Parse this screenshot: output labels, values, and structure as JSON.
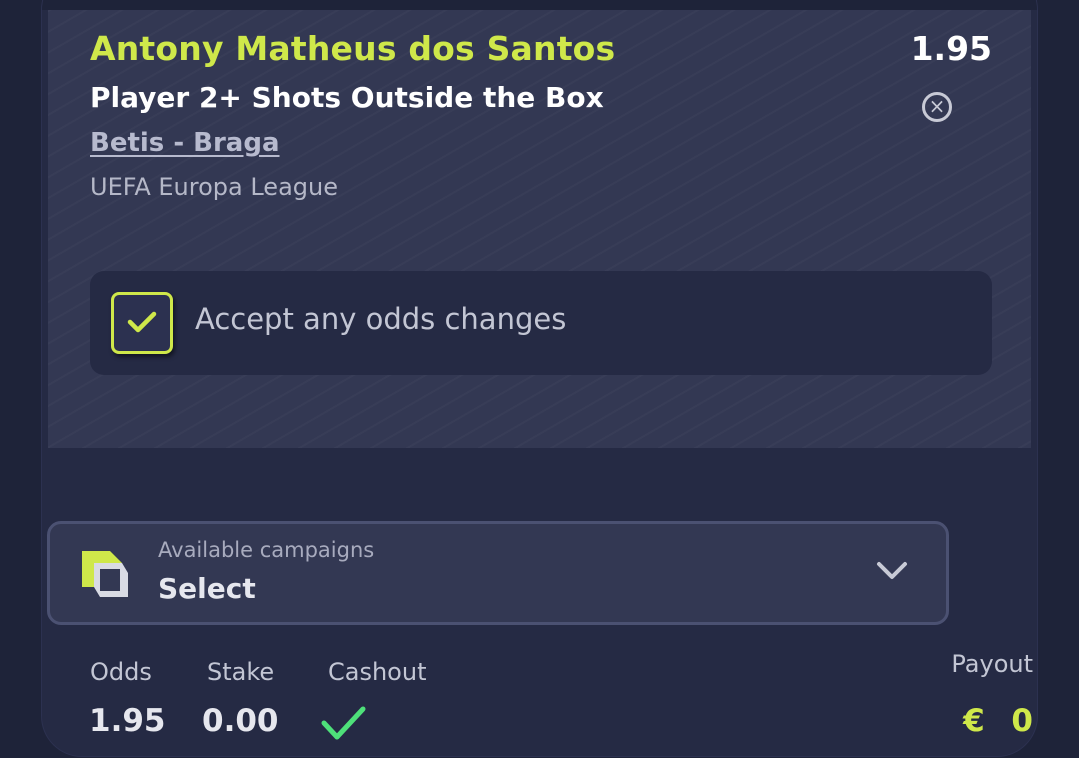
{
  "selection": {
    "player": "Antony Matheus dos Santos",
    "odds": "1.95",
    "market": "Player 2+ Shots Outside the Box",
    "match": "Betis - Braga",
    "league": "UEFA Europa League",
    "remove_icon": "close-circle-icon"
  },
  "accept_odds": {
    "label": "Accept any odds changes",
    "checked": true
  },
  "campaigns": {
    "label": "Available campaigns",
    "value": "Select",
    "icon": "campaign-logo-icon"
  },
  "summary": {
    "odds_label": "Odds",
    "odds_value": "1.95",
    "stake_label": "Stake",
    "stake_value": "0.00",
    "cashout_label": "Cashout",
    "cashout_available": true,
    "payout_label": "Payout",
    "payout_value": "€ 0"
  },
  "colors": {
    "accent": "#cfe84a",
    "background": "#1e2339",
    "card": "#252a44",
    "selection_bg": "#333853",
    "success": "#4ee07a"
  }
}
